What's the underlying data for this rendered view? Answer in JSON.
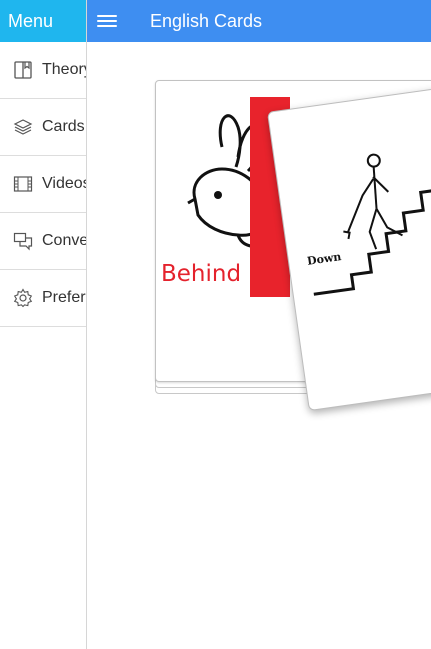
{
  "sidebar": {
    "title": "Menu",
    "items": [
      {
        "label": "Theory",
        "icon": "book-icon"
      },
      {
        "label": "Cards",
        "icon": "layers-icon"
      },
      {
        "label": "Videos",
        "icon": "film-icon"
      },
      {
        "label": "Conversations",
        "icon": "chat-icon"
      },
      {
        "label": "Preferences",
        "icon": "gear-icon"
      }
    ]
  },
  "header": {
    "title": "English Cards",
    "menu_icon": "hamburger-icon"
  },
  "cards": {
    "back": {
      "word": "Behind",
      "image": "rabbit-behind-wall"
    },
    "front": {
      "word": "Down",
      "image": "stick-figure-walking-down-stairs"
    }
  },
  "colors": {
    "sidebar_header": "#1fb6ee",
    "top_bar": "#3e8ef1",
    "card_word_red": "#e4222c"
  }
}
